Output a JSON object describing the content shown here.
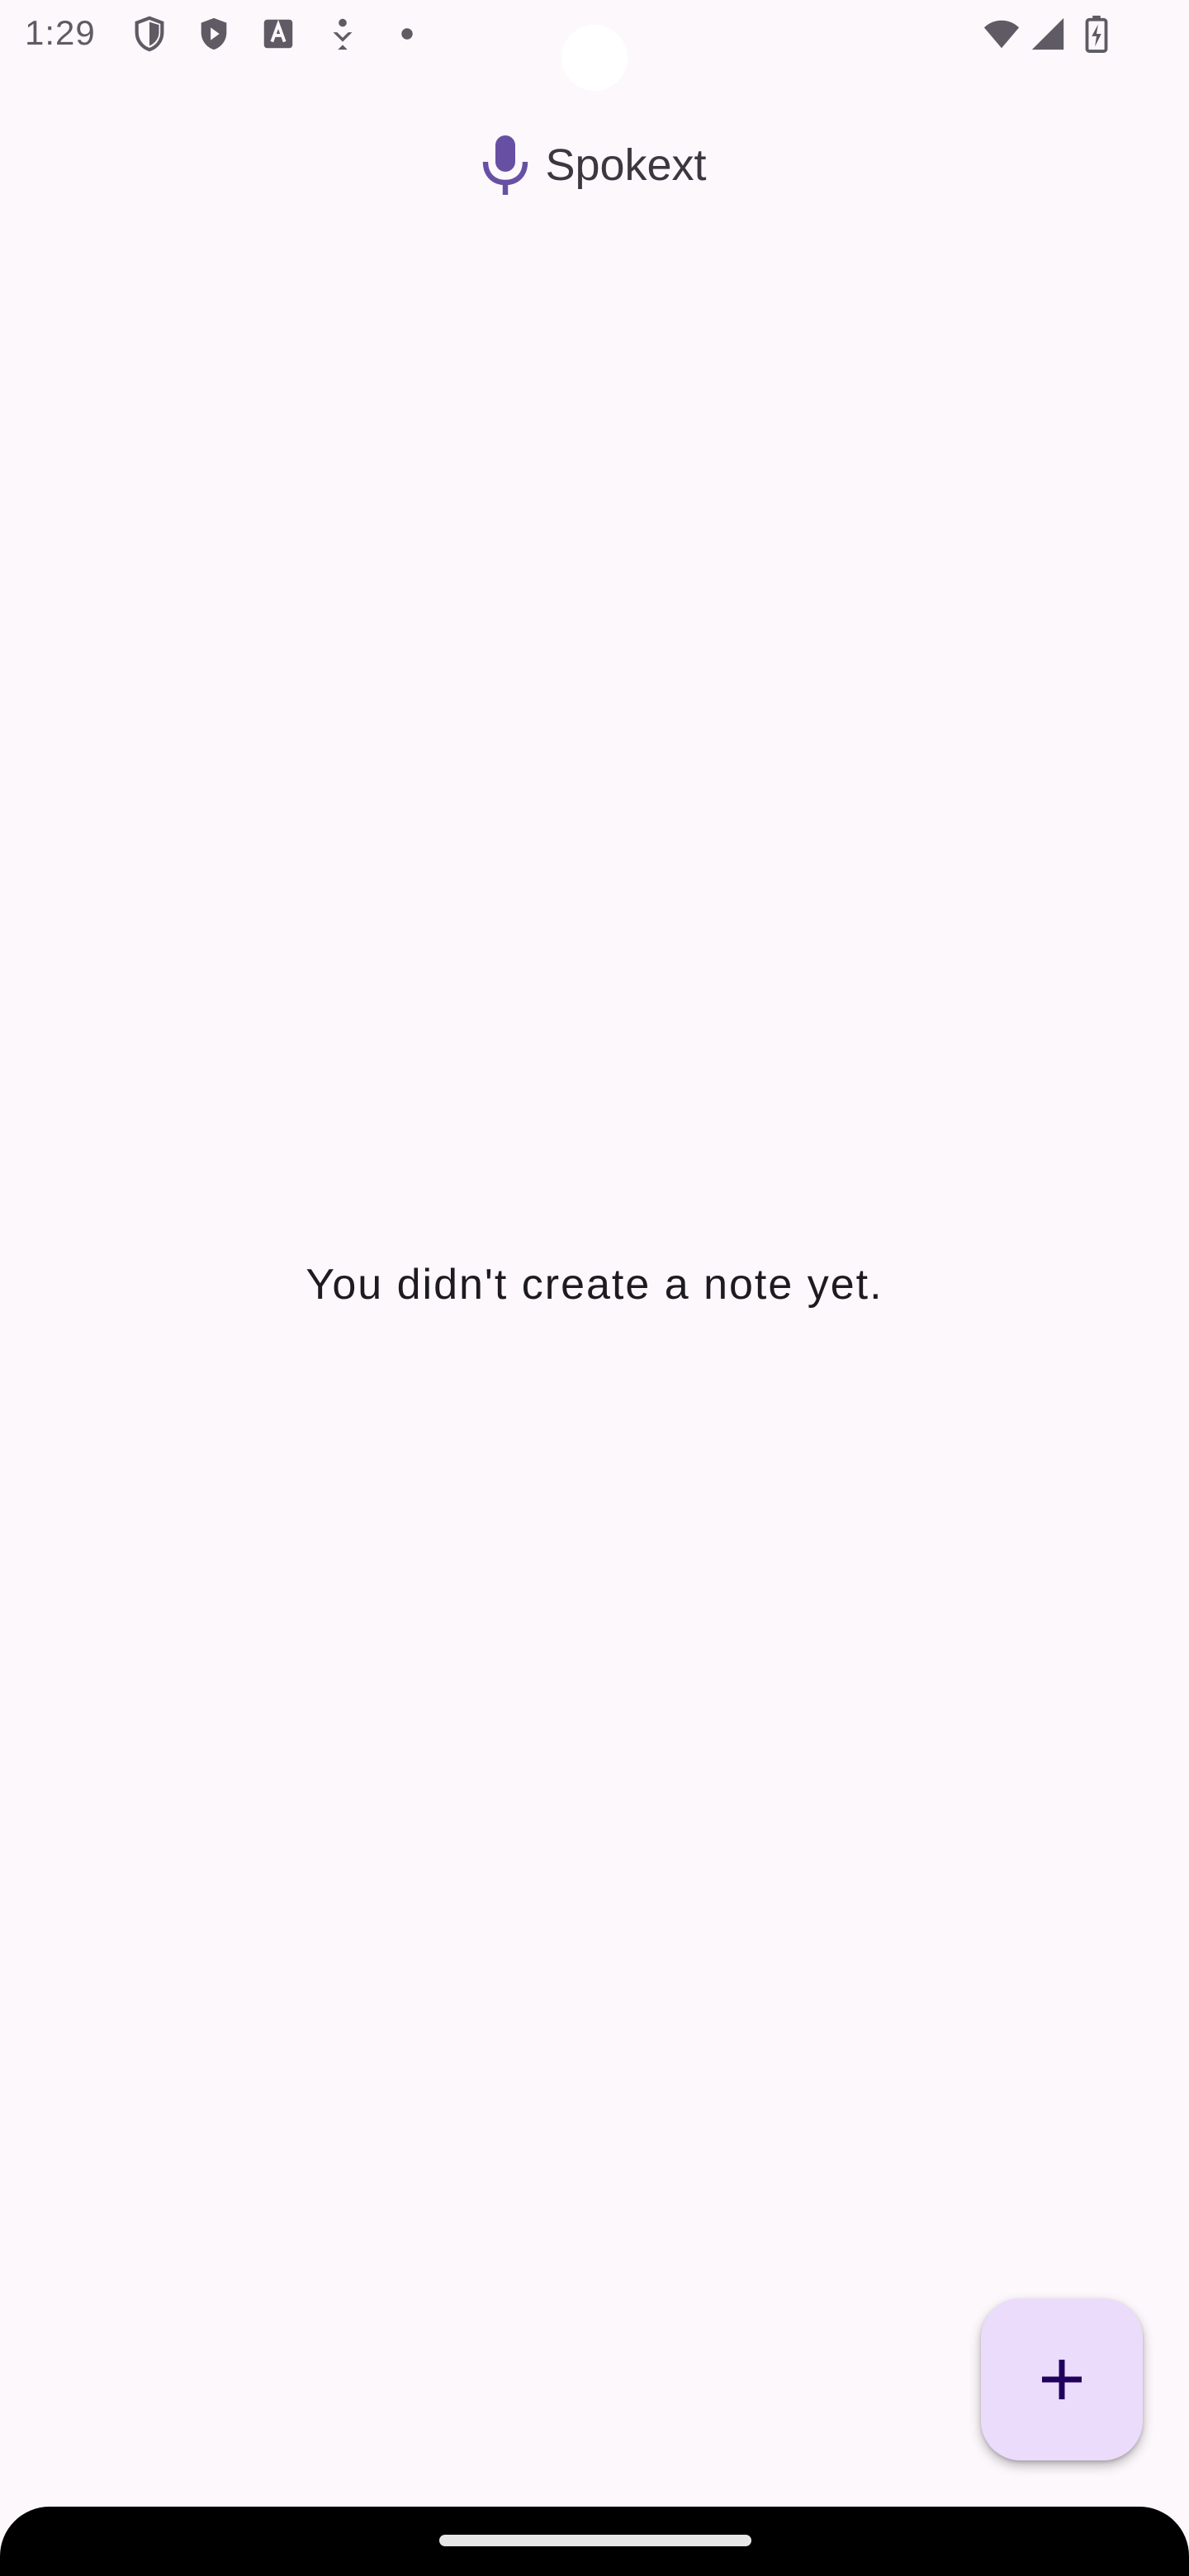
{
  "status_bar": {
    "time": "1:29",
    "icons": [
      "shield-icon",
      "play-protect-icon",
      "font-icon",
      "accessibility-icon",
      "dot-icon",
      "wifi-icon",
      "cell-signal-icon",
      "battery-charging-icon"
    ]
  },
  "app_bar": {
    "title": "Spokext",
    "logo_icon": "microphone-icon",
    "logo_color": "#6750a4"
  },
  "main": {
    "empty_message": "You didn't create a note yet."
  },
  "fab": {
    "icon": "add-icon",
    "background": "#ebdcfb",
    "icon_color": "#21005d"
  }
}
